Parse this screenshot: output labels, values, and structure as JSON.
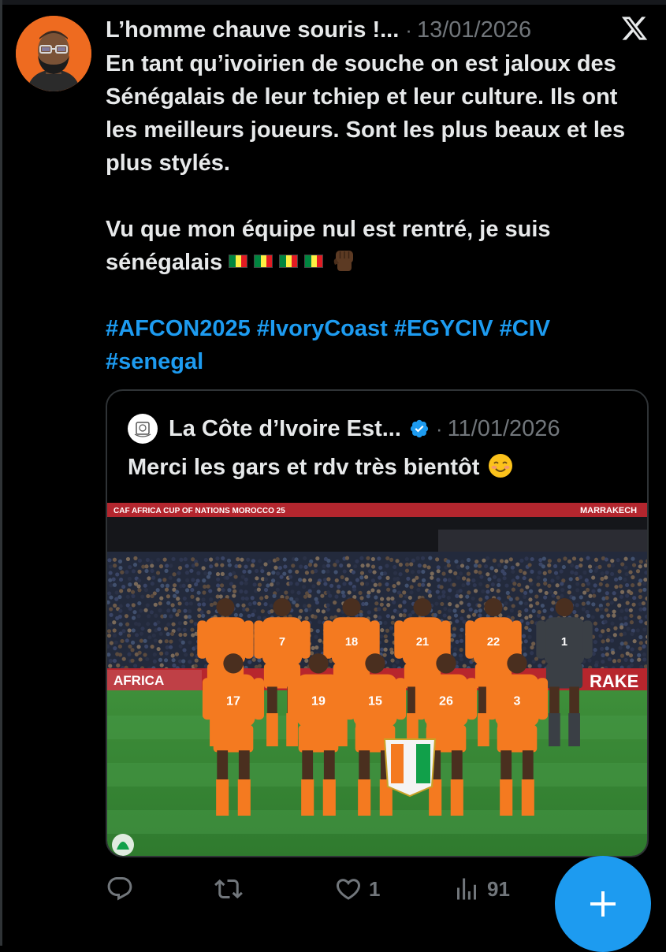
{
  "tweet": {
    "author": "L’homme chauve souris !...",
    "separator": "·",
    "date": "13/01/2026",
    "paragraph1": "En tant qu’ivoirien de souche on est jaloux des Sénégalais de leur tchiep et leur culture. Ils ont les meilleurs joueurs. Sont les plus beaux et les plus stylés.",
    "paragraph2": "Vu que mon équipe nul est rentré, je suis sénégalais",
    "hashtags": "#AFCON2025 #IvoryCoast #EGYCIV #CIV #senegal",
    "flag_count": 4
  },
  "quote": {
    "author": "La Côte d’Ivoire Est...",
    "separator": "·",
    "date": "11/01/2026",
    "text": "Merci les gars et rdv très bientôt",
    "banner_left": "CAF AFRICA CUP OF NATIONS MOROCCO 25",
    "banner_right": "MARRAKECH",
    "board_left": "AFRICA",
    "board_right": "RAKE",
    "jersey_numbers_back": [
      "7",
      "18",
      "21",
      "22",
      "1"
    ],
    "jersey_numbers_front": [
      "17",
      "19",
      "15",
      "26",
      "3"
    ]
  },
  "actions": {
    "reply_count": "",
    "retweet_count": "",
    "like_count": "1",
    "views_count": "91"
  },
  "icons": {
    "brand": "x-logo-icon",
    "verified": "verified-badge-icon",
    "reply": "reply-icon",
    "retweet": "retweet-icon",
    "like": "heart-icon",
    "views": "views-icon",
    "compose": "plus-icon"
  },
  "colors": {
    "background": "#000000",
    "text": "#e7e9ea",
    "muted": "#71767b",
    "link": "#1d9bf0",
    "fab": "#1d9bf0",
    "avatar": "#ee6b20",
    "jersey": "#f47a20"
  }
}
